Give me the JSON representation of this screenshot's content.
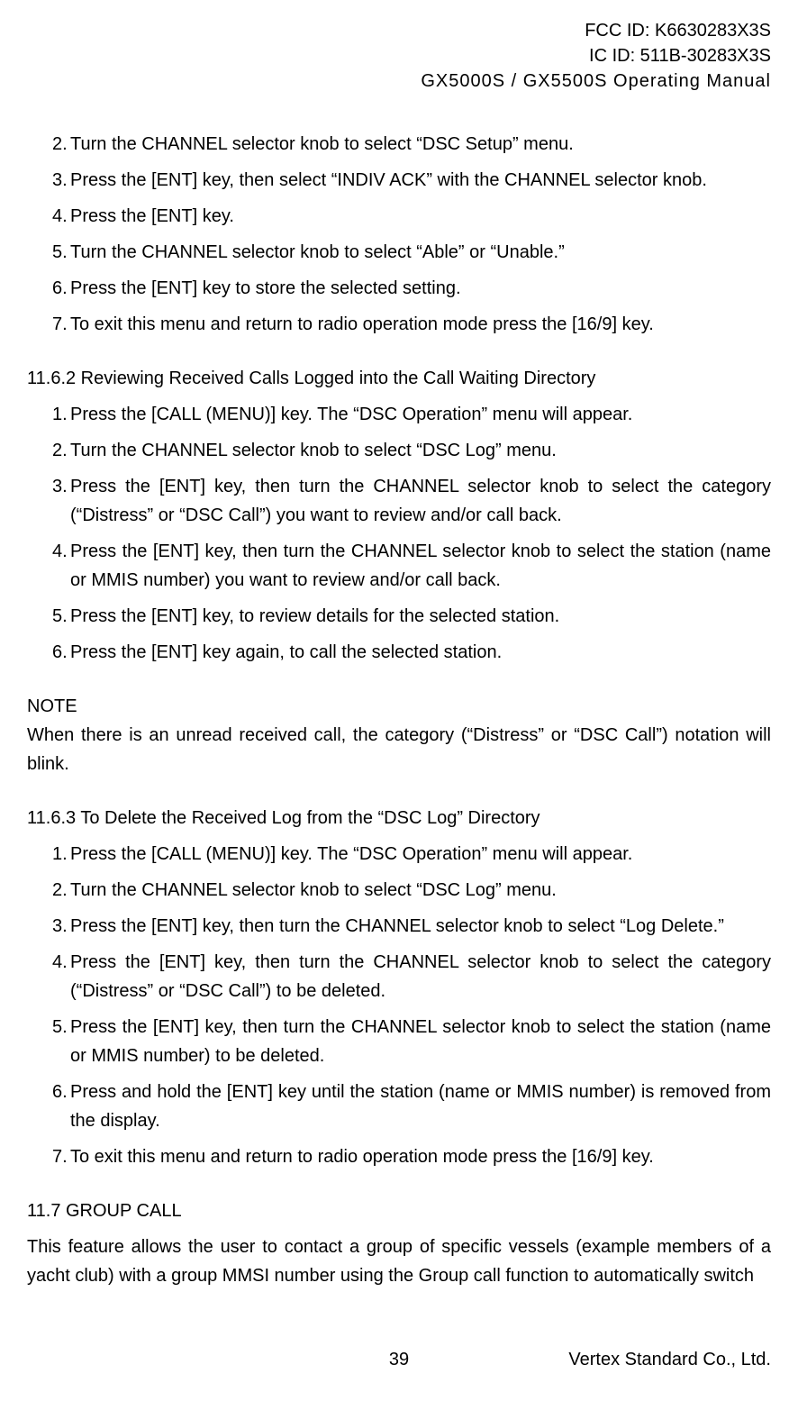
{
  "header": {
    "fcc": "FCC ID: K6630283X3S",
    "ic": "IC ID: 511B-30283X3S",
    "title": "GX5000S / GX5500S  Operating Manual"
  },
  "listA": [
    {
      "n": "2.",
      "t": "Turn the CHANNEL selector knob to select “DSC Setup” menu."
    },
    {
      "n": "3.",
      "t": "Press the [ENT] key, then select “INDIV ACK” with the CHANNEL selector knob."
    },
    {
      "n": "4.",
      "t": "Press the [ENT] key."
    },
    {
      "n": "5.",
      "t": "Turn the CHANNEL selector knob to select “Able” or “Unable.”"
    },
    {
      "n": "6.",
      "t": "Press the [ENT] key to store the selected setting."
    },
    {
      "n": "7.",
      "t": "To exit this menu and return to radio operation mode press the [16/9] key."
    }
  ],
  "sectionB": {
    "heading": "11.6.2 Reviewing Received Calls Logged into the Call Waiting Directory",
    "items": [
      {
        "n": "1.",
        "t": "Press the [CALL (MENU)] key. The “DSC Operation” menu will appear."
      },
      {
        "n": "2.",
        "t": "Turn the CHANNEL selector knob to select “DSC Log” menu."
      },
      {
        "n": "3.",
        "t": "Press the [ENT] key, then turn the CHANNEL selector knob to select the category (“Distress” or “DSC Call”) you want to review and/or call back.",
        "justify": true
      },
      {
        "n": "4.",
        "t": "Press the [ENT] key, then turn the CHANNEL selector knob to select the station (name or MMIS number) you want to review and/or call back.",
        "justify": true
      },
      {
        "n": "5.",
        "t": "Press the [ENT] key, to review details for the selected station."
      },
      {
        "n": "6.",
        "t": "Press the [ENT] key again, to call the selected station."
      }
    ]
  },
  "note": {
    "label": "NOTE",
    "body": "When there is an unread received call, the category (“Distress” or “DSC Call”) notation will blink."
  },
  "sectionC": {
    "heading": "11.6.3 To Delete the Received Log from the “DSC Log” Directory",
    "items": [
      {
        "n": "1.",
        "t": "Press the [CALL (MENU)] key. The “DSC Operation” menu will appear."
      },
      {
        "n": "2.",
        "t": "Turn the CHANNEL selector knob to select “DSC Log” menu."
      },
      {
        "n": "3.",
        "t": "Press the [ENT] key, then turn the CHANNEL selector knob to select “Log Delete.”"
      },
      {
        "n": "4.",
        "t": "Press the [ENT] key, then turn the CHANNEL selector knob to select the category (“Distress” or “DSC Call”) to be deleted.",
        "justify": true
      },
      {
        "n": "5.",
        "t": "Press the [ENT] key, then turn the CHANNEL selector knob to select the station (name or MMIS number) to be deleted.",
        "justify": true
      },
      {
        "n": "6.",
        "t": "Press and hold the [ENT] key until the station (name or MMIS number) is removed from the display.",
        "justify": true
      },
      {
        "n": "7.",
        "t": "To exit this menu and return to radio operation mode press the [16/9] key."
      }
    ]
  },
  "sectionD": {
    "heading": "11.7 GROUP CALL",
    "body": "This feature allows the user to contact a group of specific vessels (example members of a yacht club) with a group MMSI number using the Group call function to automatically switch"
  },
  "footer": {
    "page": "39",
    "company": "Vertex Standard Co., Ltd."
  }
}
